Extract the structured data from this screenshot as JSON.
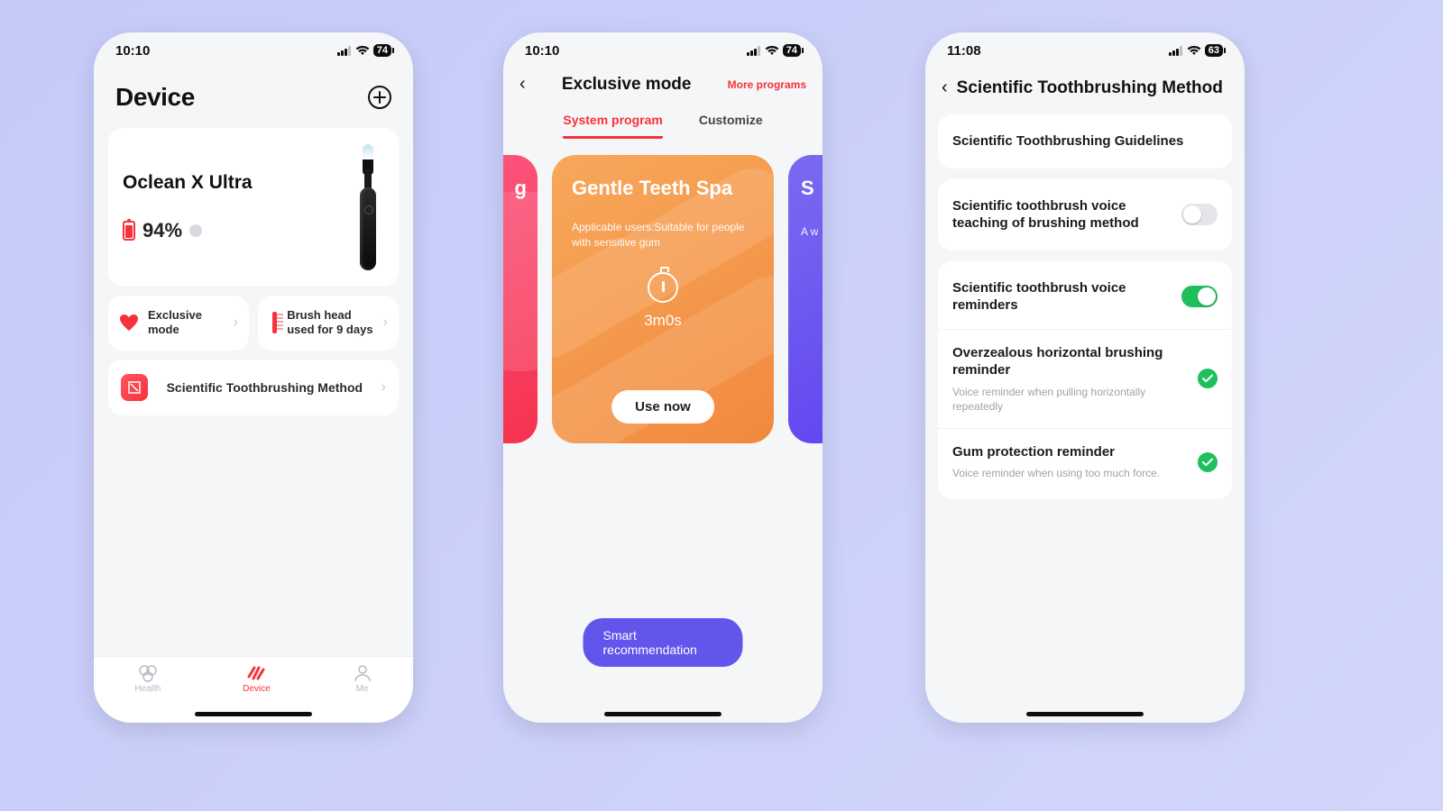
{
  "phone1": {
    "status": {
      "time": "10:10",
      "battery": "74"
    },
    "header_title": "Device",
    "device": {
      "name": "Oclean X Ultra",
      "battery_pct": "94%"
    },
    "quick1": "Exclusive mode",
    "quick2": "Brush head used for 9 days",
    "row_science": "Scientific Toothbrushing Method",
    "tabs": {
      "health": "Health",
      "device": "Device",
      "me": "Me"
    }
  },
  "phone2": {
    "status": {
      "time": "10:10",
      "battery": "74"
    },
    "title": "Exclusive mode",
    "more": "More programs",
    "tab_system": "System program",
    "tab_custom": "Customize",
    "peek_left": "g",
    "card": {
      "title": "Gentle Teeth Spa",
      "sub": "Applicable users:Suitable for people with sensitive gum",
      "duration": "3m0s",
      "button": "Use now"
    },
    "peek_right_letter": "S",
    "peek_right_sub": "A\nw",
    "smart": "Smart recommendation"
  },
  "phone3": {
    "status": {
      "time": "11:08",
      "battery": "63"
    },
    "title": "Scientific Toothbrushing Method",
    "row1": "Scientific Toothbrushing Guidelines",
    "row2": "Scientific toothbrush voice teaching of brushing method",
    "row3": "Scientific toothbrush voice reminders",
    "row4_title": "Overzealous horizontal brushing reminder",
    "row4_sub": "Voice reminder when pulling horizontally repeatedly",
    "row5_title": "Gum protection reminder",
    "row5_sub": "Voice reminder when using too much force."
  }
}
